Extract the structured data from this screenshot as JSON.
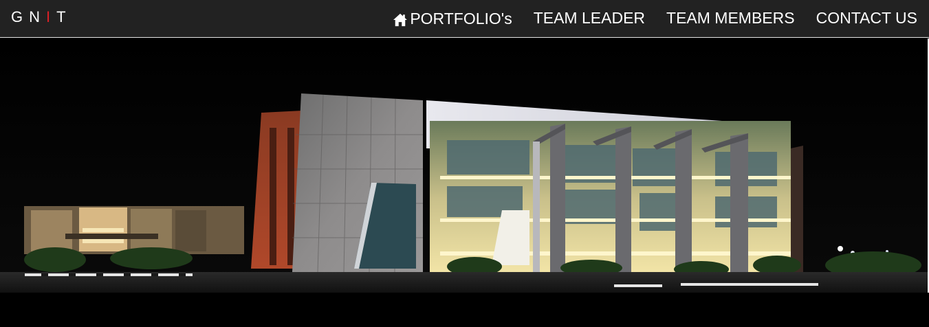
{
  "brand": {
    "letters": [
      "G",
      "N",
      "I",
      "T"
    ],
    "accent_color": "#d92027"
  },
  "nav": {
    "items": [
      {
        "label": "PORTFOLIO's",
        "icon": "home-icon"
      },
      {
        "label": "TEAM LEADER"
      },
      {
        "label": "TEAM MEMBERS"
      },
      {
        "label": "CONTACT US"
      }
    ]
  },
  "colors": {
    "navbar_bg": "#222222",
    "page_bg": "#000000"
  },
  "hero": {
    "image": "night-photo-of-college-building"
  }
}
